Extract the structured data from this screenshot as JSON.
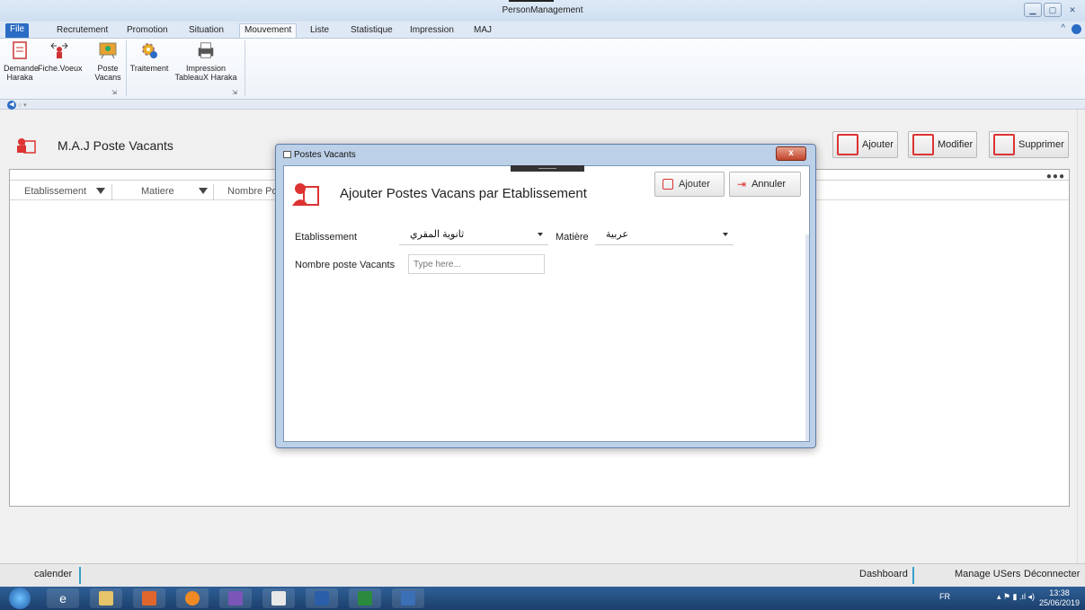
{
  "window": {
    "title": "PersonManagement",
    "controls": [
      "minimize-icon",
      "maximize-icon",
      "close-icon"
    ]
  },
  "ribbon": {
    "tabs": [
      {
        "label": "File",
        "type": "file"
      },
      {
        "label": "Recrutement"
      },
      {
        "label": "Promotion"
      },
      {
        "label": "Situation"
      },
      {
        "label": "Mouvement",
        "active": true
      },
      {
        "label": "Liste"
      },
      {
        "label": "Statistique"
      },
      {
        "label": "Impression"
      },
      {
        "label": "MAJ"
      }
    ],
    "buttons": {
      "demande_line1": "Demande",
      "demande_line2": "Haraka",
      "fiche_voeux": "Fiche.Voeux",
      "poste_line1": "Poste",
      "poste_line2": "Vacans",
      "traitement": "Traitement",
      "impression_line1": "Impression",
      "impression_line2": "TableauX Haraka"
    }
  },
  "page": {
    "title": "M.A.J Poste Vacants",
    "actions": {
      "add": "Ajouter",
      "edit": "Modifier",
      "delete": "Supprimer"
    },
    "grid": {
      "columns": [
        "Etablissement",
        "Matiere",
        "Nombre Po"
      ],
      "more_icon": "●●●"
    }
  },
  "dialog": {
    "title": "Postes Vacants",
    "heading": "Ajouter Postes Vacans par Etablissement",
    "add_button": "Ajouter",
    "cancel_button": "Annuler",
    "close_label": "x",
    "fields": {
      "etablissement_label": "Etablissement",
      "etablissement_value": "ثانوية المقري",
      "matiere_label": "Matière",
      "matiere_value": "عربية",
      "nombre_label": "Nombre poste Vacants",
      "nombre_placeholder": "Type here..."
    }
  },
  "statusbar": {
    "left": "calender",
    "dashboard": "Dashboard",
    "manage_users": "Manage USers",
    "logout": "Déconnecter"
  },
  "taskbar": {
    "lang": "FR",
    "time": "13:38",
    "date": "25/06/2019"
  },
  "colors": {
    "accent": "#2b6cc4",
    "danger": "#d33333",
    "statusline": "#3aa0c8"
  }
}
